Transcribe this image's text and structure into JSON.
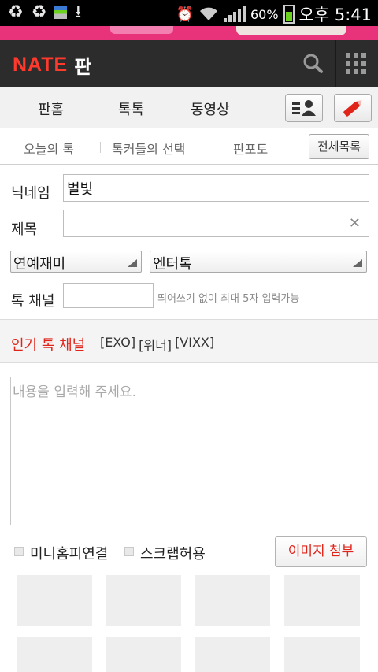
{
  "status_bar": {
    "battery_percent": "60%",
    "clock": "오후 5:41",
    "icons": [
      "recycle-icon",
      "recycle-icon",
      "storage-icon",
      "download-icon",
      "alarm-icon",
      "wifi-icon",
      "signal-icon",
      "battery-icon"
    ]
  },
  "header": {
    "logo_brand": "NATE",
    "logo_title": "판",
    "accent_color": "#ff3a2c"
  },
  "tabs": {
    "items": [
      {
        "label": "판홈"
      },
      {
        "label": "톡톡"
      },
      {
        "label": "동영상"
      }
    ]
  },
  "subnav": {
    "items": [
      {
        "label": "오늘의 톡"
      },
      {
        "label": "톡커들의 선택"
      },
      {
        "label": "판포토"
      }
    ],
    "all_button": "전체목록"
  },
  "form": {
    "nickname_label": "닉네임",
    "nickname_value": "벌빛",
    "title_label": "제목",
    "title_value": "",
    "category_select": "연예재미",
    "subcategory_select": "엔터톡",
    "channel_label": "톡 채널",
    "channel_value": "",
    "channel_hint": "띄어쓰기 없이 최대 5자 입력가능"
  },
  "popular": {
    "label": "인기 톡 채널",
    "tags": [
      "[EXO]",
      "[위너]",
      "[VIXX]"
    ]
  },
  "content": {
    "placeholder": "내용을 입력해 주세요."
  },
  "options": {
    "minihompy": "미니홈피연결",
    "scrap": "스크랩허용",
    "image_button": "이미지 첨부"
  }
}
